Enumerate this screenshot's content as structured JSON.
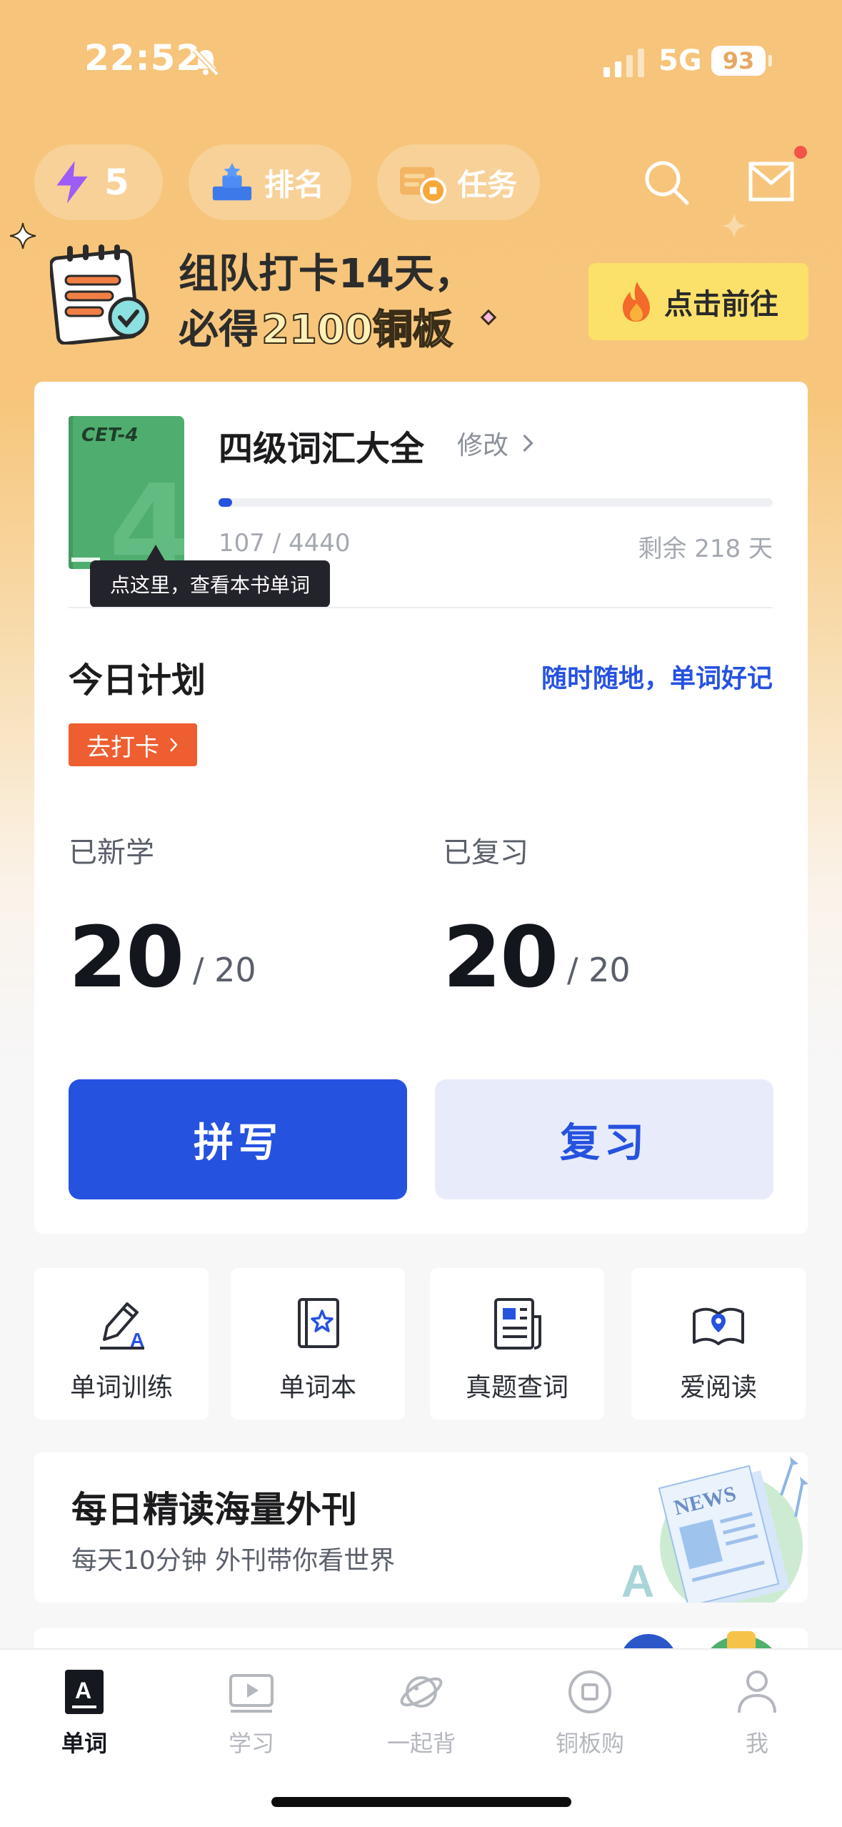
{
  "status_bar": {
    "time": "22:52",
    "network": "5G",
    "battery": "93"
  },
  "header": {
    "energy_count": "5",
    "rank_label": "排名",
    "task_label": "任务"
  },
  "promo": {
    "line1": "组队打卡14天，",
    "line2_prefix": "必得",
    "line2_highlight": "2100铜板",
    "cta_label": "点击前往"
  },
  "book": {
    "cover_level": "CET-4",
    "cover_number": "4",
    "title": "四级词汇大全",
    "edit_label": "修改",
    "progress_done": 107,
    "progress_total": 4440,
    "progress_text": "107 / 4440",
    "remaining_text": "剩余 218 天",
    "tooltip": "点这里，查看本书单词"
  },
  "plan": {
    "title": "今日计划",
    "slogan": "随时随地，单词好记",
    "checkin_label": "去打卡",
    "new_label": "已新学",
    "new_value": "20",
    "new_total": "/ 20",
    "review_label": "已复习",
    "review_value": "20",
    "review_total": "/ 20",
    "spell_button": "拼写",
    "review_button": "复习"
  },
  "tools": [
    {
      "label": "单词训练",
      "icon": "pencil-letter-icon"
    },
    {
      "label": "单词本",
      "icon": "wordbook-star-icon"
    },
    {
      "label": "真题查词",
      "icon": "newspaper-icon"
    },
    {
      "label": "爱阅读",
      "icon": "open-book-location-icon"
    }
  ],
  "reading": {
    "title": "每日精读海量外刊",
    "subtitle": "每天10分钟 外刊带你看世界",
    "illus_text": "NEWS",
    "illus_letter": "A"
  },
  "tabs": [
    {
      "label": "单词",
      "icon": "word-a-icon",
      "active": true
    },
    {
      "label": "学习",
      "icon": "play-screen-icon",
      "active": false
    },
    {
      "label": "一起背",
      "icon": "planet-icon",
      "active": false
    },
    {
      "label": "铜板购",
      "icon": "coin-icon",
      "active": false
    },
    {
      "label": "我",
      "icon": "person-icon",
      "active": false
    }
  ],
  "colors": {
    "primary": "#2652e0",
    "accent_orange": "#ef5e31",
    "background_top": "#f6c47a",
    "cta_yellow": "#fbe16a"
  }
}
